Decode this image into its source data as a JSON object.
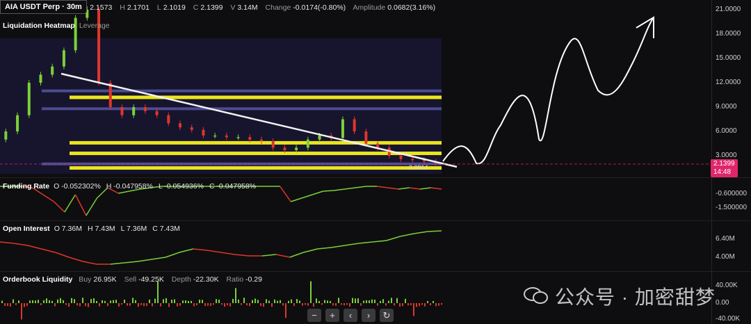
{
  "header": {
    "symbol": "AIA USDT Perp · 30m",
    "o_label": "O",
    "o": "2.1573",
    "h_label": "H",
    "h": "2.1701",
    "l_label": "L",
    "l": "2.1019",
    "c_label": "C",
    "c": "2.1399",
    "v_label": "V",
    "v": "3.14M",
    "change_label": "Change",
    "change": "-0.0174(-0.80%)",
    "amp_label": "Amplitude",
    "amp": "0.0682(3.16%)"
  },
  "heatmap": {
    "title": "Liquidation Heatmap",
    "sub": "Leverage",
    "current_price": "2.1399",
    "countdown": "14:48",
    "marker_price": "2.0914"
  },
  "funding": {
    "title": "Funding Rate",
    "o": "O -0.052302%",
    "h": "H -0.047958%",
    "l": "L -0.054936%",
    "c": "C -0.047958%",
    "ticks": [
      "-0.600000",
      "-1.500000"
    ]
  },
  "oi": {
    "title": "Open Interest",
    "o": "O 7.36M",
    "h": "H 7.43M",
    "l": "L 7.36M",
    "c": "C 7.43M",
    "ticks": [
      "6.40M",
      "4.00M"
    ]
  },
  "ob": {
    "title": "Orderbook Liquidity",
    "buy_label": "Buy",
    "buy": "26.95K",
    "sell_label": "Sell",
    "sell": "-49.25K",
    "depth_label": "Depth",
    "depth": "-22.30K",
    "ratio_label": "Ratio",
    "ratio": "-0.29",
    "ticks": [
      "40.00K",
      "0.00",
      "-40.00K"
    ]
  },
  "nav": {
    "zoom_out": "−",
    "zoom_in": "+",
    "left": "‹",
    "right": "›",
    "reset": "↻"
  },
  "watermark": "公众号 · 加密甜梦",
  "colors": {
    "up": "#7bd13a",
    "down": "#e0352b",
    "heat_high": "#f5f01e",
    "heat_mid": "#5a5aa8",
    "tag": "#e0266b"
  },
  "chart_data": {
    "type": "line",
    "price_axis": {
      "ticks": [
        "21.0000",
        "18.0000",
        "15.0000",
        "12.0000",
        "9.0000",
        "6.0000",
        "3.0000"
      ],
      "range": [
        0,
        22
      ]
    },
    "price_closes": [
      5,
      6,
      8,
      12,
      13,
      14,
      16,
      20,
      21,
      12,
      9,
      8,
      9,
      8.5,
      8,
      7,
      6.5,
      6.2,
      5.5,
      5.5,
      5.3,
      5.3,
      5.0,
      4.8,
      4.0,
      3.7,
      4.0,
      5.0,
      5.5,
      5.2,
      7.5,
      6,
      4.5,
      4.0,
      3.0,
      2.6,
      2.5,
      2.3,
      2.14
    ],
    "heat_levels": [
      {
        "price": 10.2,
        "intensity": "high"
      },
      {
        "price": 11.0,
        "intensity": "mid"
      },
      {
        "price": 8.8,
        "intensity": "mid"
      },
      {
        "price": 4.6,
        "intensity": "high"
      },
      {
        "price": 3.3,
        "intensity": "high"
      },
      {
        "price": 1.5,
        "intensity": "high"
      },
      {
        "price": 2.0,
        "intensity": "mid"
      }
    ]
  }
}
